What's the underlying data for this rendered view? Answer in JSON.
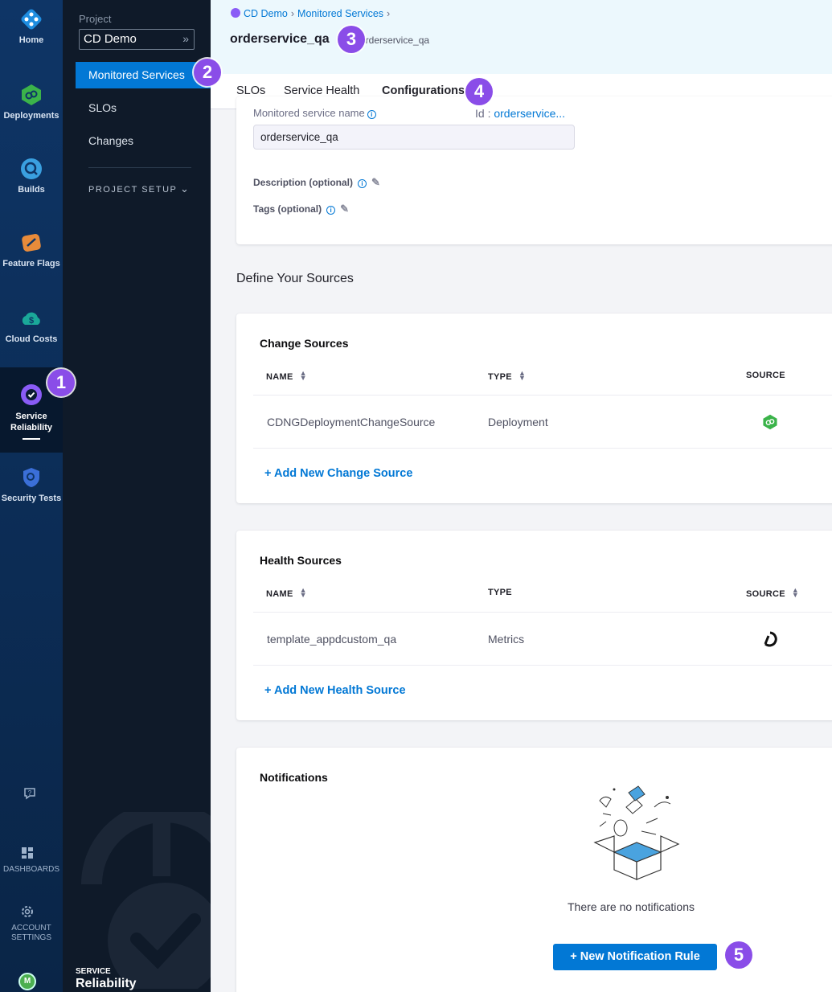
{
  "rail": {
    "items": [
      {
        "label": "Home",
        "icon": "harness-logo-icon"
      },
      {
        "label": "Deployments",
        "icon": "deployments-icon"
      },
      {
        "label": "Builds",
        "icon": "builds-icon"
      },
      {
        "label": "Feature Flags",
        "icon": "feature-flags-icon"
      },
      {
        "label": "Cloud Costs",
        "icon": "cloud-costs-icon"
      },
      {
        "label": "Service Reliability",
        "icon": "service-reliability-icon"
      },
      {
        "label": "Security Tests",
        "icon": "security-tests-icon"
      }
    ],
    "dashboards": "DASHBOARDS",
    "account_settings": "ACCOUNT SETTINGS",
    "avatar_initial": "M"
  },
  "panel": {
    "project_label": "Project",
    "project_name": "CD Demo",
    "nav": [
      "Monitored Services",
      "SLOs",
      "Changes"
    ],
    "project_setup": "PROJECT SETUP",
    "module_title_small": "SERVICE",
    "module_title_big": "Reliability"
  },
  "breadcrumbs": [
    "CD Demo",
    "Monitored Services"
  ],
  "page": {
    "title": "orderservice_qa",
    "subtitle": "orderservice_qa"
  },
  "tabs": [
    "SLOs",
    "Service Health",
    "Configurations"
  ],
  "overview": {
    "name_label": "Monitored service name",
    "id_label": "Id : ",
    "id_value": "orderservice...",
    "name_value": "orderservice_qa",
    "description_label": "Description (optional)",
    "tags_label": "Tags (optional)"
  },
  "sources_title": "Define Your Sources",
  "change_sources": {
    "title": "Change Sources",
    "headers": [
      "NAME",
      "TYPE",
      "SOURCE"
    ],
    "rows": [
      {
        "name": "CDNGDeploymentChangeSource",
        "type": "Deployment"
      }
    ],
    "add_label": "Add New Change Source"
  },
  "health_sources": {
    "title": "Health Sources",
    "headers": [
      "NAME",
      "TYPE",
      "SOURCE"
    ],
    "rows": [
      {
        "name": "template_appdcustom_qa",
        "type": "Metrics"
      }
    ],
    "add_label": "Add New Health Source"
  },
  "notifications": {
    "title": "Notifications",
    "empty_text": "There are no notifications",
    "button_label": "New Notification Rule"
  },
  "callouts": [
    "1",
    "2",
    "3",
    "4",
    "5"
  ],
  "colors": {
    "primary": "#0278d5",
    "callout": "#8a4de8",
    "rail_bg": "#0e3566",
    "panel_bg": "#0f1a29"
  }
}
